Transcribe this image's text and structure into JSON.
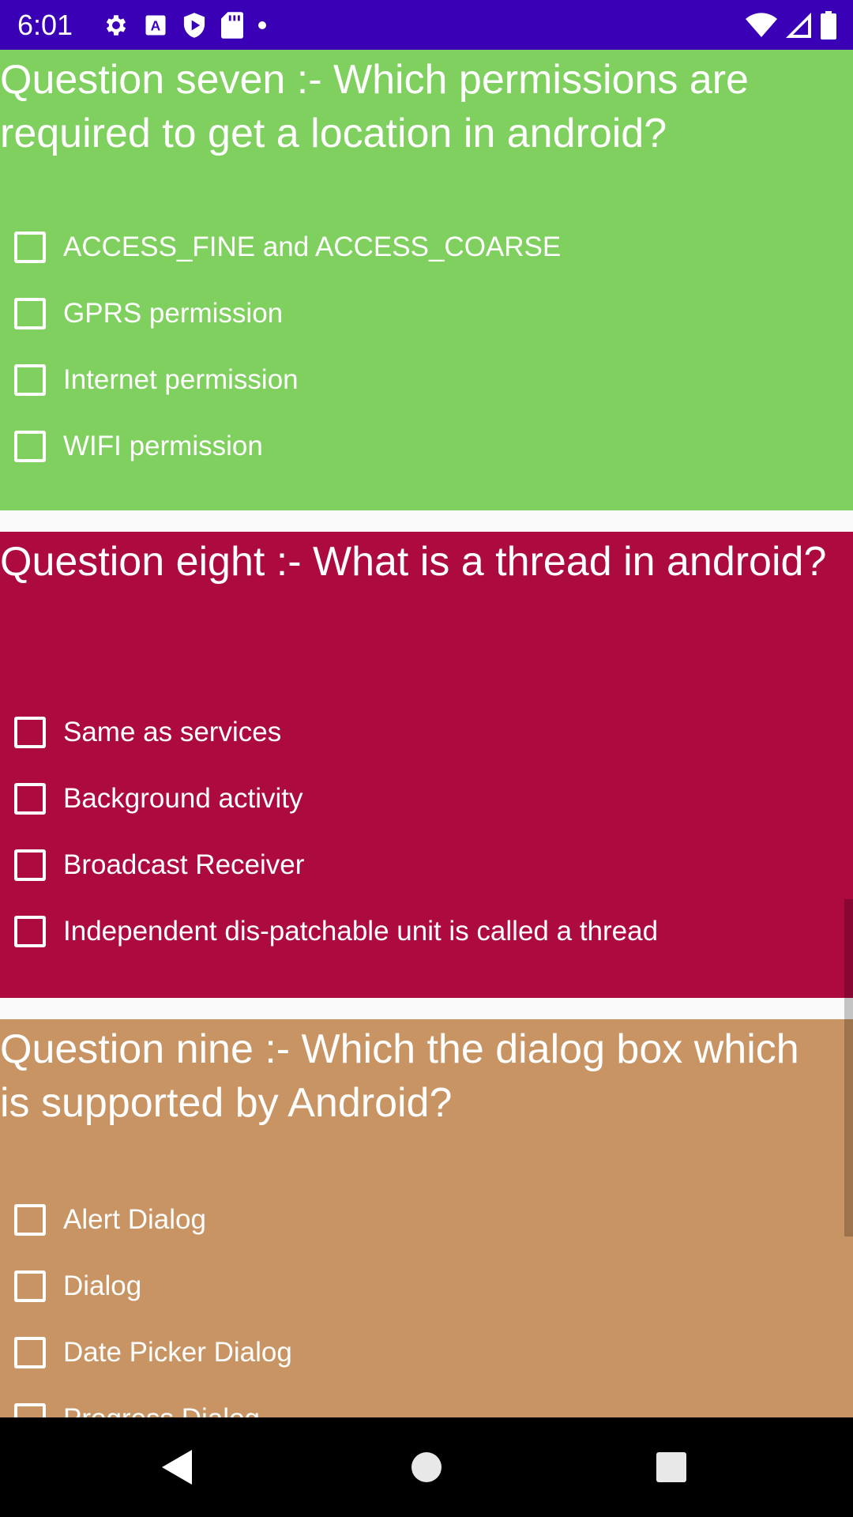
{
  "status_bar": {
    "time": "6:01",
    "background": "#3a00b5",
    "left_icons": [
      "gear-icon",
      "app-a-icon",
      "shield-play-icon",
      "sd-card-icon",
      "dot-icon"
    ],
    "right_icons": [
      "wifi-icon",
      "cell-signal-icon",
      "battery-icon"
    ]
  },
  "questions": [
    {
      "title": "Question seven :- Which permissions are required to get a location in android?",
      "background": "#80d060",
      "options": [
        "ACCESS_FINE and ACCESS_COARSE",
        "GPRS permission",
        "Internet permission",
        "WIFI permission"
      ]
    },
    {
      "title": "Question eight :- What is a thread in android?",
      "background": "#ad0a40",
      "options": [
        "Same as services",
        "Background activity",
        "Broadcast Receiver",
        "Independent dis-patchable unit is called a thread"
      ]
    },
    {
      "title": "Question nine :- Which the dialog box which is supported by Android?",
      "background": "#c99463",
      "options": [
        "Alert Dialog",
        "Dialog",
        "Date Picker Dialog",
        "Progress Dialog"
      ]
    }
  ],
  "nav_bar": {
    "buttons": [
      "back-icon",
      "home-icon",
      "recents-icon"
    ]
  }
}
